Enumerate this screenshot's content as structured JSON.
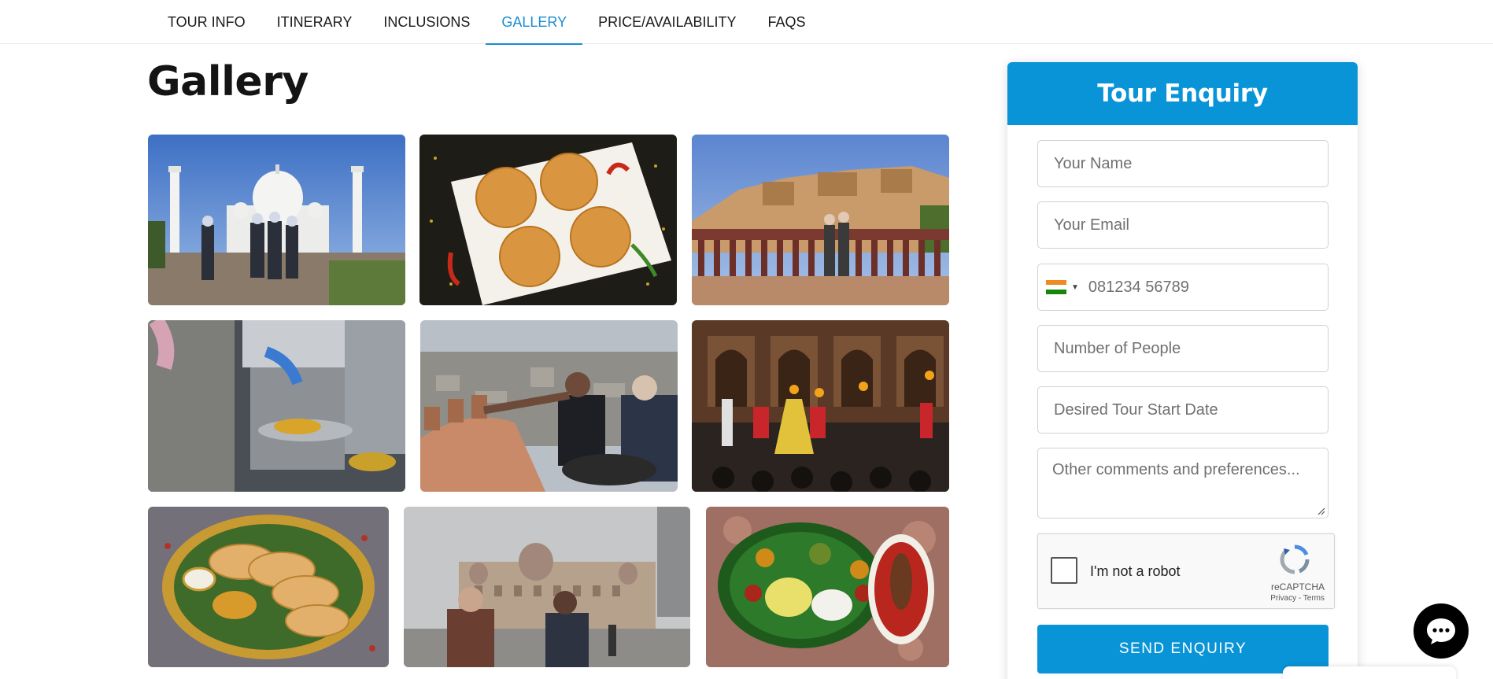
{
  "nav": {
    "tabs": [
      {
        "label": "TOUR INFO"
      },
      {
        "label": "ITINERARY"
      },
      {
        "label": "INCLUSIONS"
      },
      {
        "label": "GALLERY"
      },
      {
        "label": "PRICE/AVAILABILITY"
      },
      {
        "label": "FAQS"
      }
    ],
    "active_tab": "GALLERY",
    "accent_color": "#1a8ed1"
  },
  "gallery": {
    "title": "Gallery",
    "images": [
      {
        "subject": "Taj Mahal with tour group"
      },
      {
        "subject": "Fried kachori snacks on paper"
      },
      {
        "subject": "Amber Fort with travellers on terrace"
      },
      {
        "subject": "Street food being served"
      },
      {
        "subject": "Guide pointing over Jaipur city view"
      },
      {
        "subject": "Evening folk dance performance"
      },
      {
        "subject": "Parathas on brass plate"
      },
      {
        "subject": "Taj Mahal Palace hotel Mumbai with travellers"
      },
      {
        "subject": "South Indian thali with fish curry"
      }
    ]
  },
  "enquiry": {
    "title": "Tour Enquiry",
    "header_color": "#0894d6",
    "name_placeholder": "Your Name",
    "email_placeholder": "Your Email",
    "phone_placeholder": "081234 56789",
    "phone_flag": "india-flag-icon",
    "people_placeholder": "Number of People",
    "date_placeholder": "Desired Tour Start Date",
    "comments_placeholder": "Other comments and preferences...",
    "captcha": {
      "label": "I'm not a robot",
      "brand": "reCAPTCHA",
      "links": "Privacy - Terms"
    },
    "submit_label": "SEND ENQUIRY"
  },
  "chat": {
    "icon": "chat-bubble-icon"
  }
}
